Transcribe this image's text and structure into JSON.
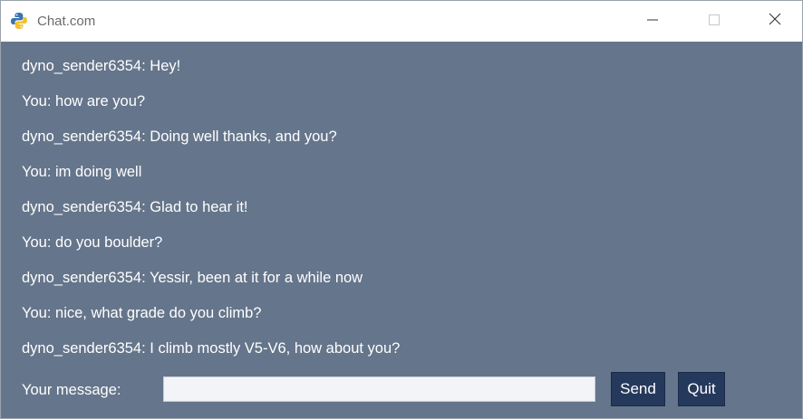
{
  "window": {
    "title": "Chat.com",
    "icon": "python-icon",
    "controls": [
      "minimize-icon",
      "maximize-icon",
      "close-icon"
    ]
  },
  "messages": [
    "dyno_sender6354: Hey!",
    "You: how are you?",
    "dyno_sender6354: Doing well thanks, and you?",
    "You: im doing well",
    "dyno_sender6354: Glad to hear it!",
    "You: do you boulder?",
    "dyno_sender6354: Yessir, been at it for a while now",
    "You: nice, what grade do you climb?",
    "dyno_sender6354: I climb mostly V5-V6, how about you?"
  ],
  "composer": {
    "label": "Your message:",
    "value": "",
    "placeholder": "",
    "send_label": "Send",
    "quit_label": "Quit"
  },
  "colors": {
    "chat_background": "#65758b",
    "button_background": "#25395c",
    "text": "#ffffff"
  }
}
